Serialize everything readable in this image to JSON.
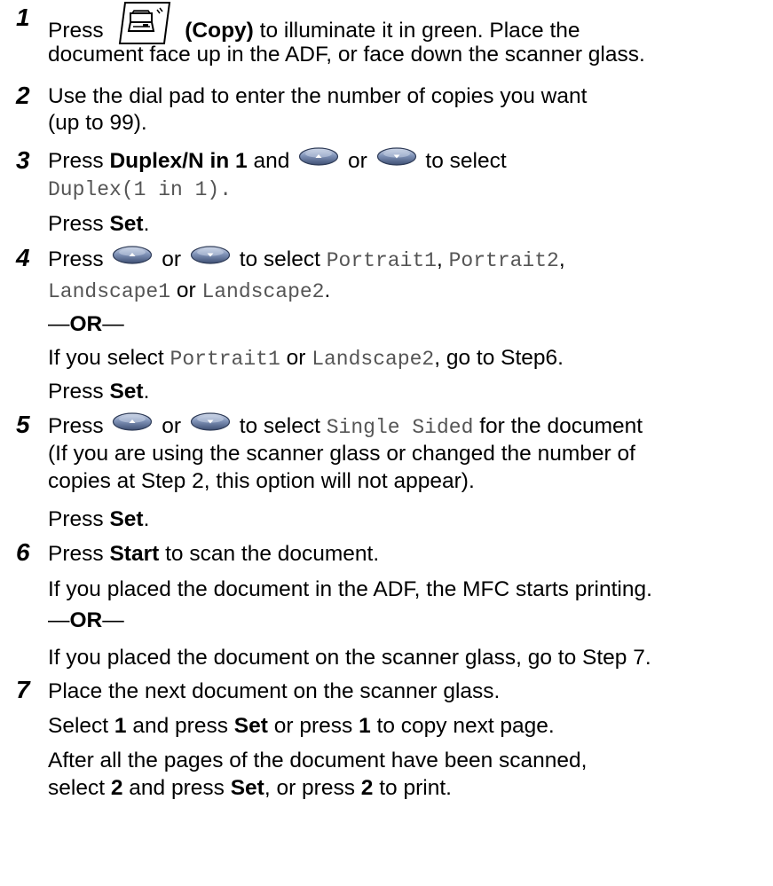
{
  "steps": [
    {
      "number": "1",
      "lines": [
        {
          "pre": "Press",
          "bold": "(Copy)",
          "post": "to illuminate it in green. Place the"
        },
        {
          "text": "document face up in the ADF, or face down the scanner glass."
        }
      ],
      "icon": "copy-button-icon"
    },
    {
      "number": "2",
      "lines": [
        {
          "text": "Use the dial pad to enter the number of copies you want"
        },
        {
          "text": "(up to 99)."
        }
      ]
    },
    {
      "number": "3",
      "lines": [
        {
          "pre": "Press",
          "bold": "Duplex/N in 1",
          "mid": "and",
          "or": "or",
          "post": "to select"
        },
        {
          "mono": "Duplex(1 in 1)."
        },
        {
          "pre": "Press",
          "bold": "Set",
          "post": "."
        }
      ]
    },
    {
      "number": "4",
      "lines": [
        {
          "pre": "Press",
          "or": "or",
          "mid": "to select",
          "m1": "Portrait1",
          "m2": "Portrait2",
          "sep": ","
        },
        {
          "m1": "Landscape1",
          "or": "or",
          "m2": "Landscape2",
          "end": "."
        },
        {
          "dash_or": "OR"
        },
        {
          "pre": "If you select",
          "m1": "Portrait1",
          "or": "or",
          "m2": "Landscape2",
          "post": ", go to Step6."
        },
        {
          "pre": "Press",
          "bold": "Set",
          "post": "."
        }
      ]
    },
    {
      "number": "5",
      "lines": [
        {
          "pre": "Press",
          "or": "or",
          "mid": "to select",
          "m1": "Single Sided",
          "post": "for the document"
        },
        {
          "text": "(If you are using the scanner glass or changed the number of"
        },
        {
          "text": "copies at Step 2, this option will not appear)."
        },
        {
          "pre": "Press",
          "bold": "Set",
          "post": "."
        }
      ]
    },
    {
      "number": "6",
      "lines": [
        {
          "pre": "Press",
          "bold": "Start",
          "post": "to scan the document."
        },
        {
          "text": "If you placed the document in the ADF, the MFC starts printing."
        },
        {
          "dash_or": "OR"
        },
        {
          "text": "If you placed the document on the scanner glass, go to Step 7."
        }
      ]
    },
    {
      "number": "7",
      "lines": [
        {
          "text": "Place the next document on the scanner glass."
        },
        {
          "pre": "Select",
          "b1": "1",
          "mid": "and press",
          "bold": "Set",
          "mid2": "or press",
          "b2": "1",
          "post": "to copy next page."
        },
        {
          "text": "After all the pages of the document have been scanned,"
        },
        {
          "pre": "select",
          "b1": "2",
          "mid": "and press",
          "bold": "Set",
          "mid2": ", or press",
          "b2": "2",
          "post": "to print."
        }
      ]
    }
  ],
  "dash": "—",
  "icons": {
    "copy": "copy-button-icon",
    "up": "up-arrow-key-icon",
    "down": "down-arrow-key-icon"
  },
  "colors": {
    "key_fill": "#5a6f96",
    "key_highlight": "#c9d3e6"
  }
}
